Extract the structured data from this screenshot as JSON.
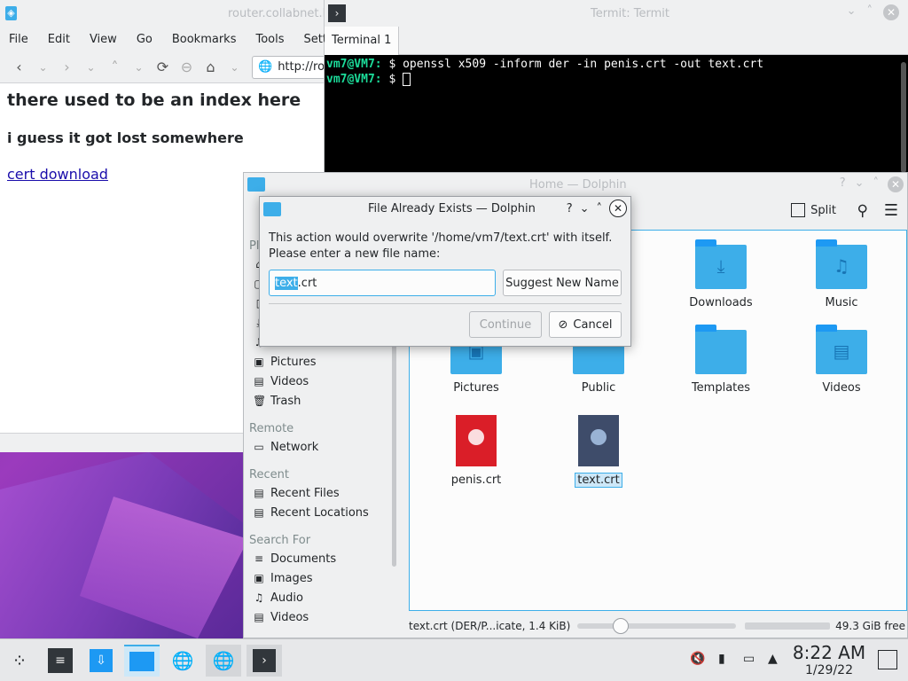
{
  "browser": {
    "title": "router.collabnet.loca",
    "menu": [
      "File",
      "Edit",
      "View",
      "Go",
      "Bookmarks",
      "Tools",
      "Setting"
    ],
    "url": "http://ro",
    "heading1": "there used to be an index here",
    "heading2": "i guess it got lost somewhere",
    "link": "cert download"
  },
  "terminal": {
    "title": "Termit: Termit",
    "tab": "Terminal 1",
    "lines": [
      {
        "prompt": "vm7@VM7:",
        "rest": " $ openssl x509 -inform der -in penis.crt -out text.crt"
      },
      {
        "prompt": "vm7@VM7:",
        "rest": " $ "
      }
    ]
  },
  "dolphin": {
    "title": "Home — Dolphin",
    "split_label": "Split",
    "sidebar_places_label": "Pl",
    "sidebar": {
      "places": [
        {
          "icon": "⌂",
          "label": ""
        },
        {
          "icon": "▢",
          "label": ""
        },
        {
          "icon": "▯",
          "label": ""
        },
        {
          "icon": "⤓",
          "label": ""
        },
        {
          "icon": "♫",
          "label": ""
        },
        {
          "icon": "▣",
          "label": "Pictures"
        },
        {
          "icon": "▤",
          "label": "Videos"
        },
        {
          "icon": "🗑",
          "label": "Trash"
        }
      ],
      "remote_label": "Remote",
      "remote": [
        {
          "icon": "▭",
          "label": "Network"
        }
      ],
      "recent_label": "Recent",
      "recent": [
        {
          "icon": "▤",
          "label": "Recent Files"
        },
        {
          "icon": "▤",
          "label": "Recent Locations"
        }
      ],
      "search_label": "Search For",
      "search": [
        {
          "icon": "≡",
          "label": "Documents"
        },
        {
          "icon": "▣",
          "label": "Images"
        },
        {
          "icon": "♫",
          "label": "Audio"
        },
        {
          "icon": "▤",
          "label": "Videos"
        }
      ]
    },
    "files": {
      "downloads": "Downloads",
      "music": "Music",
      "pictures": "Pictures",
      "public": "Public",
      "templates": "Templates",
      "videos": "Videos",
      "penis": "penis.crt",
      "text": "text.crt"
    },
    "status_info": "text.crt (DER/P...icate, 1.4 KiB)",
    "free_space": "49.3 GiB free"
  },
  "dialog": {
    "title": "File Already Exists — Dolphin",
    "message_line1": "This action would overwrite '/home/vm7/text.crt' with itself.",
    "message_line2": "Please enter a new file name:",
    "input_selected": "text",
    "input_rest": ".crt",
    "suggest_label": "Suggest New Name",
    "continue_label": "Continue",
    "cancel_label": "Cancel"
  },
  "taskbar": {
    "time": "8:22 AM",
    "date": "1/29/22"
  },
  "colors": {
    "accent": "#3daee9",
    "prompt": "#1cdc9a",
    "red_file": "#da1e28"
  }
}
